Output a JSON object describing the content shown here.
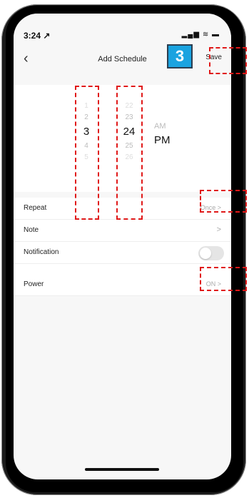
{
  "status_bar": {
    "time": "3:24 ↗",
    "icons": "▂▄▆ ≋ ▬"
  },
  "nav": {
    "back_icon": "‹",
    "title": "Add Schedule",
    "save_label": "Save"
  },
  "annotation": {
    "step_number": "3",
    "color": "#e01818",
    "badge_color": "#1aa3e0"
  },
  "picker": {
    "hours": [
      "1",
      "2",
      "3",
      "4",
      "5"
    ],
    "hours_selected_index": 2,
    "minutes": [
      "22",
      "23",
      "24",
      "25",
      "26"
    ],
    "minutes_selected_index": 2,
    "am_pm": [
      "AM",
      "PM"
    ],
    "am_pm_selected": "PM"
  },
  "rows": {
    "repeat": {
      "label": "Repeat",
      "value": "Once >"
    },
    "note": {
      "label": "Note",
      "chevron": ">"
    },
    "notification": {
      "label": "Notification",
      "enabled": false
    },
    "power": {
      "label": "Power",
      "value": "ON >"
    }
  }
}
